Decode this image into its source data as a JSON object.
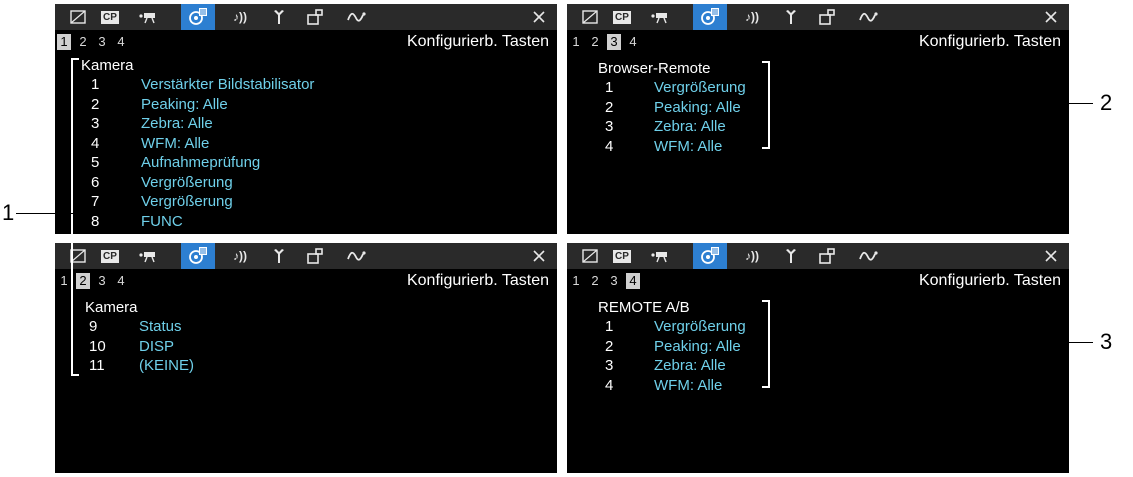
{
  "close_icon_glyph": "×",
  "tabs": [
    {
      "name": "camera-setup-icon"
    },
    {
      "name": "custom-picture-icon",
      "glyph": "CP"
    },
    {
      "name": "recording-icon"
    },
    {
      "name": "assign-buttons-icon",
      "active": true
    },
    {
      "name": "audio-icon",
      "glyph": "♪))"
    },
    {
      "name": "system-icon"
    },
    {
      "name": "monitoring-icon"
    },
    {
      "name": "network-icon"
    }
  ],
  "accent_color": "#2d7fd1",
  "value_color": "#6fd0ea",
  "screens": [
    {
      "pages": [
        "1",
        "2",
        "3",
        "4"
      ],
      "active_page": "1",
      "title": "Konfigurierb. Tasten",
      "section": "Kamera",
      "items": [
        {
          "num": "1",
          "value": "Verstärkter Bildstabilisator"
        },
        {
          "num": "2",
          "value": "Peaking: Alle"
        },
        {
          "num": "3",
          "value": "Zebra: Alle"
        },
        {
          "num": "4",
          "value": "WFM: Alle"
        },
        {
          "num": "5",
          "value": "Aufnahmeprüfung"
        },
        {
          "num": "6",
          "value": "Vergrößerung"
        },
        {
          "num": "7",
          "value": "Vergrößerung"
        },
        {
          "num": "8",
          "value": "FUNC"
        }
      ]
    },
    {
      "pages": [
        "1",
        "2",
        "3",
        "4"
      ],
      "active_page": "3",
      "title": "Konfigurierb. Tasten",
      "section": "Browser-Remote",
      "items": [
        {
          "num": "1",
          "value": "Vergrößerung"
        },
        {
          "num": "2",
          "value": "Peaking: Alle"
        },
        {
          "num": "3",
          "value": "Zebra: Alle"
        },
        {
          "num": "4",
          "value": "WFM: Alle"
        }
      ]
    },
    {
      "pages": [
        "1",
        "2",
        "3",
        "4"
      ],
      "active_page": "2",
      "title": "Konfigurierb. Tasten",
      "section": "Kamera",
      "items": [
        {
          "num": "9",
          "value": "Status"
        },
        {
          "num": "10",
          "value": "DISP"
        },
        {
          "num": "11",
          "value": "(KEINE)"
        }
      ]
    },
    {
      "pages": [
        "1",
        "2",
        "3",
        "4"
      ],
      "active_page": "4",
      "title": "Konfigurierb. Tasten",
      "section": "REMOTE A/B",
      "items": [
        {
          "num": "1",
          "value": "Vergrößerung"
        },
        {
          "num": "2",
          "value": "Peaking: Alle"
        },
        {
          "num": "3",
          "value": "Zebra: Alle"
        },
        {
          "num": "4",
          "value": "WFM: Alle"
        }
      ]
    }
  ],
  "callouts": [
    "1",
    "2",
    "3"
  ]
}
